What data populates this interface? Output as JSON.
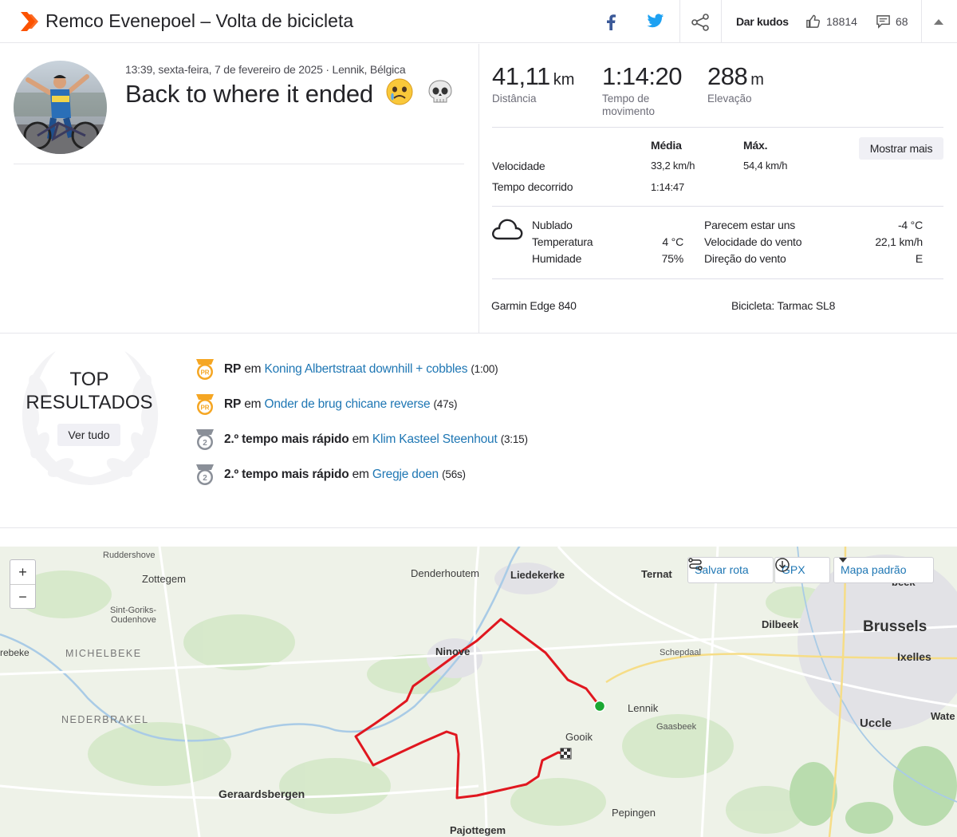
{
  "header": {
    "title": "Remco Evenepoel – Volta de bicicleta",
    "kudos_label": "Dar kudos",
    "kudos_count": "18814",
    "comments_count": "68"
  },
  "activity": {
    "meta": "13:39, sexta-feira, 7 de fevereiro de 2025 · Lennik, Bélgica",
    "title": "Back to where it ended"
  },
  "stats": {
    "distance": {
      "value": "41,11",
      "unit": "km",
      "label": "Distância"
    },
    "moving_time": {
      "value": "1:14:20",
      "label": "Tempo de movimento"
    },
    "elevation": {
      "value": "288",
      "unit": "m",
      "label": "Elevação"
    }
  },
  "more_table": {
    "col_avg": "Média",
    "col_max": "Máx.",
    "show_more": "Mostrar mais",
    "rows": [
      {
        "label": "Velocidade",
        "avg": "33,2 km/h",
        "max": "54,4 km/h"
      },
      {
        "label": "Tempo decorrido",
        "avg": "1:14:47",
        "max": ""
      }
    ]
  },
  "weather": {
    "condition": "Nublado",
    "temp_label": "Temperatura",
    "temp_value": "4 °C",
    "humidity_label": "Humidade",
    "humidity_value": "75%",
    "feels_label": "Parecem estar uns",
    "feels_value": "-4 °C",
    "wind_speed_label": "Velocidade do vento",
    "wind_speed_value": "22,1 km/h",
    "wind_dir_label": "Direção do vento",
    "wind_dir_value": "E"
  },
  "gear": {
    "device": "Garmin Edge 840",
    "bike": "Bicicleta: Tarmac SL8"
  },
  "top_results": {
    "title_line1": "TOP",
    "title_line2": "RESULTADOS",
    "see_all": "Ver tudo",
    "items": [
      {
        "badge": "pr",
        "prefix": "RP",
        "connector": "em",
        "segment": "Koning Albertstraat downhill + cobbles",
        "time": "(1:00)"
      },
      {
        "badge": "pr",
        "prefix": "RP",
        "connector": "em",
        "segment": "Onder de brug chicane reverse",
        "time": "(47s)"
      },
      {
        "badge": "2nd",
        "prefix": "2.º tempo mais rápido",
        "connector": "em",
        "segment": "Klim Kasteel Steenhout",
        "time": "(3:15)"
      },
      {
        "badge": "2nd",
        "prefix": "2.º tempo mais rápido",
        "connector": "em",
        "segment": "Gregje doen",
        "time": "(56s)"
      }
    ]
  },
  "map": {
    "zoom_in": "+",
    "zoom_out": "−",
    "save_route": "Salvar rota",
    "gpx": "GPX",
    "map_type": "Mapa padrão",
    "places": {
      "ruddershove": "Ruddershove",
      "zottegem": "Zottegem",
      "sint_goriks": "Sint-Goriks-",
      "oudenhove": "Oudenhove",
      "michelbeke": "MICHELBEKE",
      "nederbrakel": "NEDERBRAKEL",
      "rebeke": "rebeke",
      "denderhoutem": "Denderhoutem",
      "liedekerke": "Liedekerke",
      "ternat": "Ternat",
      "dilbeek": "Dilbeek",
      "brussels": "Brussels",
      "ixelles": "Ixelles",
      "ninove": "Ninove",
      "schepdaal": "Schepdaal",
      "lennik": "Lennik",
      "gaasbeek": "Gaasbeek",
      "gooik": "Gooik",
      "uccle": "Uccle",
      "geraardsbergen": "Geraardsbergen",
      "pepingen": "Pepingen",
      "pajottegem": "Pajottegem",
      "wate": "Wate",
      "beek": "beek"
    }
  }
}
